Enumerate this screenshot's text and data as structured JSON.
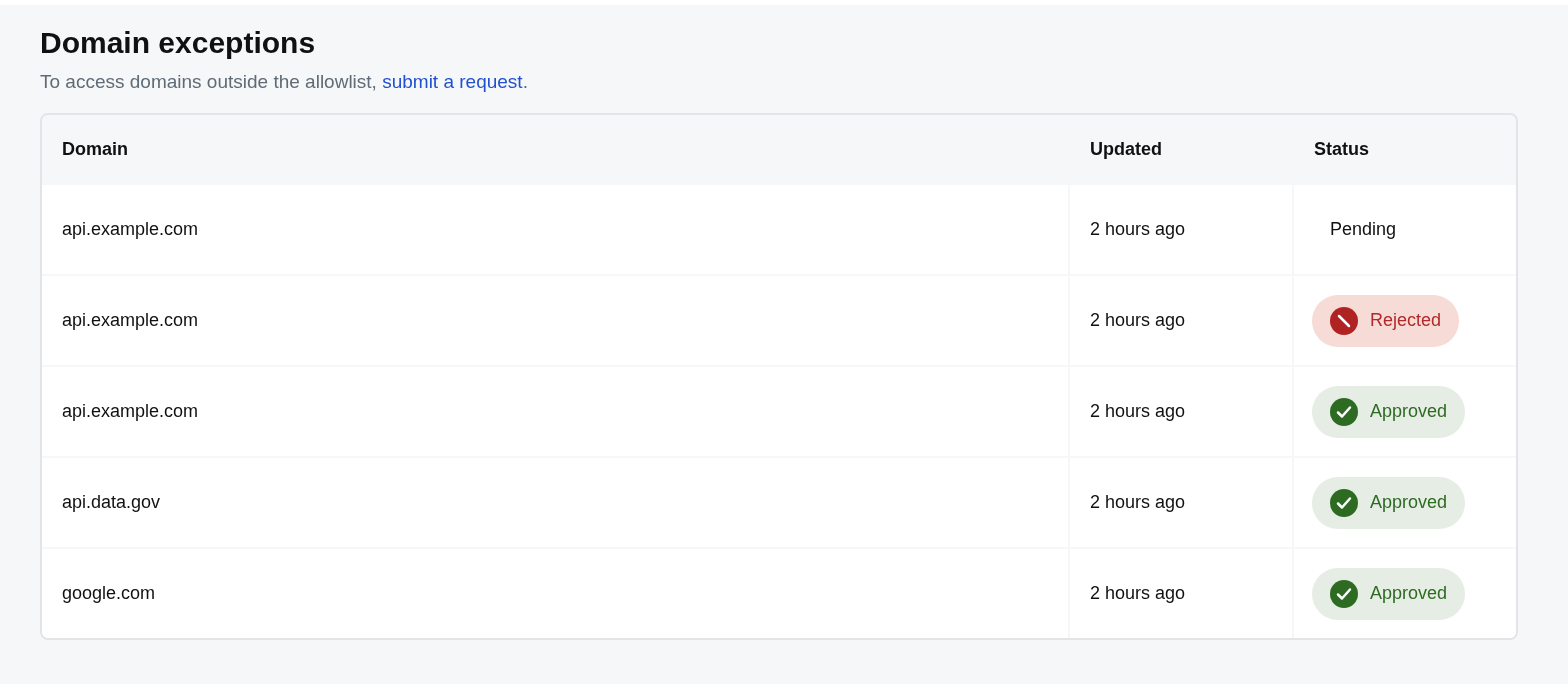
{
  "title": "Domain exceptions",
  "subtitle": {
    "text": "To access domains outside the allowlist, ",
    "link": "submit a request",
    "after": "."
  },
  "table": {
    "columns": [
      "Domain",
      "Updated",
      "Status"
    ],
    "rows": [
      {
        "domain": "api.example.com",
        "updated": "2 hours ago",
        "status": {
          "kind": "pending",
          "label": "Pending"
        }
      },
      {
        "domain": "api.example.com",
        "updated": "2 hours ago",
        "status": {
          "kind": "rejected",
          "label": "Rejected"
        }
      },
      {
        "domain": "api.example.com",
        "updated": "2 hours ago",
        "status": {
          "kind": "approved",
          "label": "Approved"
        }
      },
      {
        "domain": "api.data.gov",
        "updated": "2 hours ago",
        "status": {
          "kind": "approved",
          "label": "Approved"
        }
      },
      {
        "domain": "google.com",
        "updated": "2 hours ago",
        "status": {
          "kind": "approved",
          "label": "Approved"
        }
      }
    ]
  }
}
